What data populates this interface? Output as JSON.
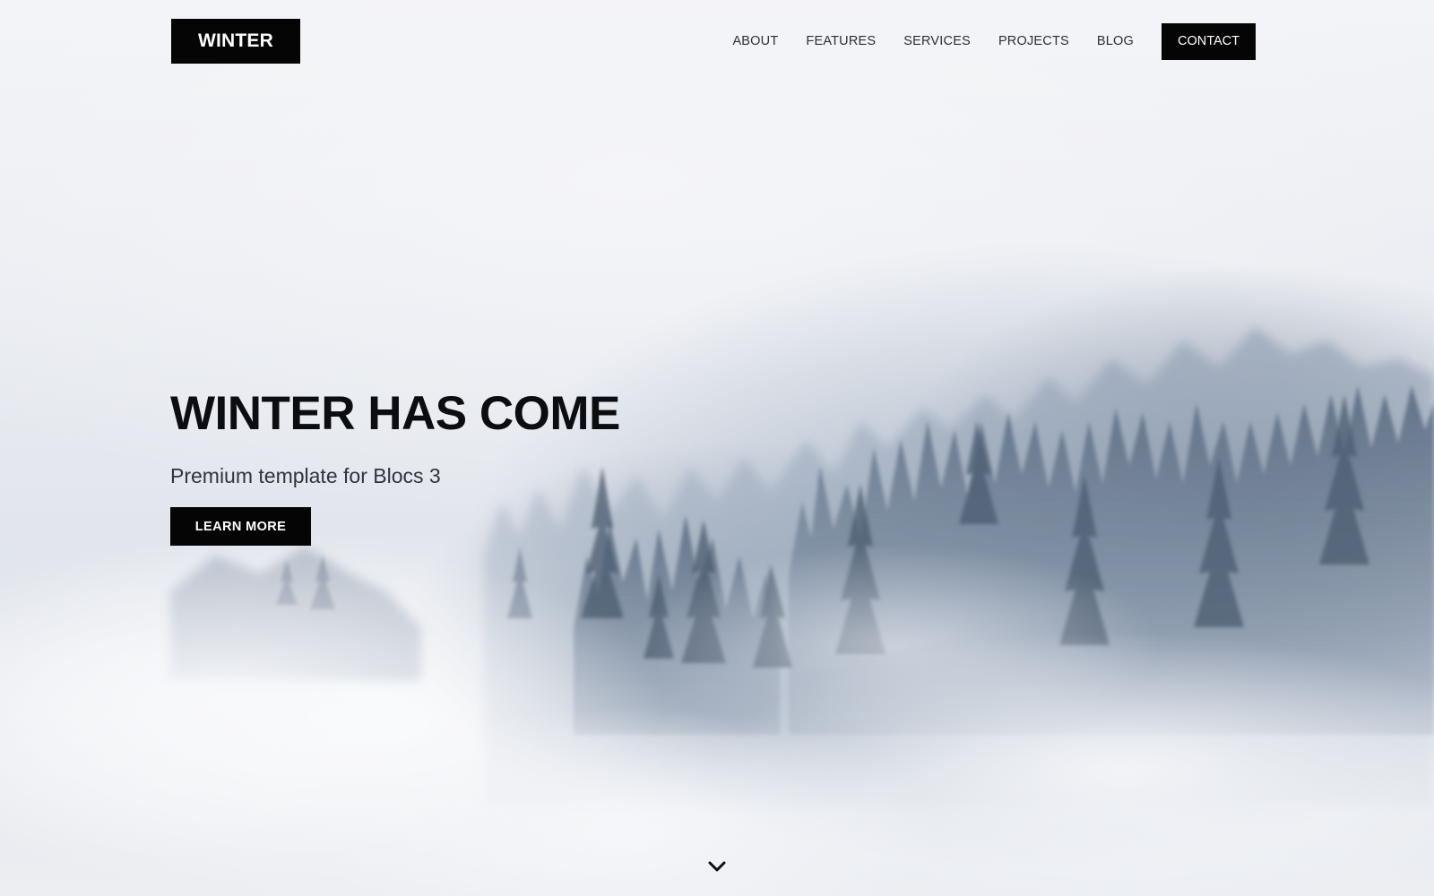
{
  "brand": {
    "logo_text": "WINTER"
  },
  "nav": {
    "items": [
      {
        "label": "ABOUT"
      },
      {
        "label": "FEATURES"
      },
      {
        "label": "SERVICES"
      },
      {
        "label": "PROJECTS"
      },
      {
        "label": "BLOG"
      }
    ],
    "cta_label": "CONTACT"
  },
  "hero": {
    "title": "WINTER HAS COME",
    "subtitle": "Premium template for Blocs 3",
    "button_label": "LEARN MORE"
  },
  "scroll": {
    "icon": "chevron-down-icon"
  },
  "colors": {
    "accent": "#050505",
    "text": "#0c0d10",
    "background": "#eef0f4"
  }
}
